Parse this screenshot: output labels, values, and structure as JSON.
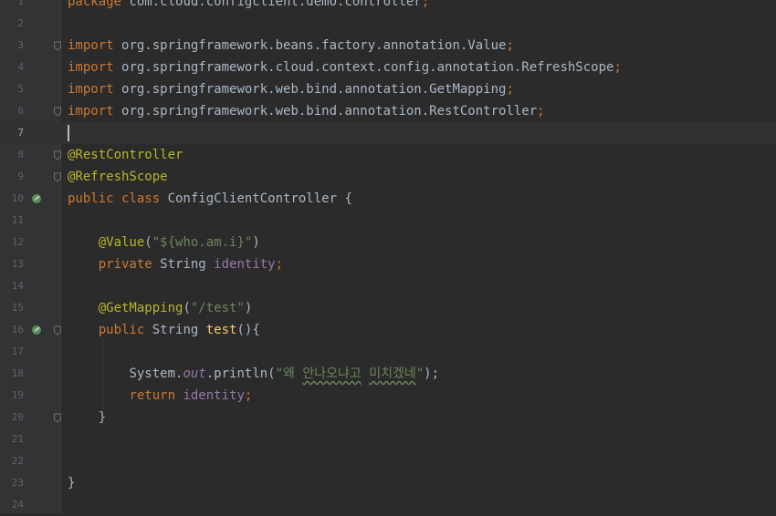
{
  "editor": {
    "current_line": 7,
    "lines": [
      {
        "n": "1",
        "tokens": [
          {
            "t": "package ",
            "c": "kw"
          },
          {
            "t": "com.cloud.configclient.demo.controller",
            "c": "plain"
          },
          {
            "t": ";",
            "c": "kw"
          }
        ]
      },
      {
        "n": "2",
        "tokens": []
      },
      {
        "n": "3",
        "fold": true,
        "tokens": [
          {
            "t": "import ",
            "c": "kw"
          },
          {
            "t": "org.springframework.beans.factory.annotation.Value",
            "c": "plain"
          },
          {
            "t": ";",
            "c": "kw"
          }
        ]
      },
      {
        "n": "4",
        "tokens": [
          {
            "t": "import ",
            "c": "kw"
          },
          {
            "t": "org.springframework.cloud.context.config.annotation.RefreshScope",
            "c": "plain"
          },
          {
            "t": ";",
            "c": "kw"
          }
        ]
      },
      {
        "n": "5",
        "tokens": [
          {
            "t": "import ",
            "c": "kw"
          },
          {
            "t": "org.springframework.web.bind.annotation.GetMapping",
            "c": "plain"
          },
          {
            "t": ";",
            "c": "kw"
          }
        ]
      },
      {
        "n": "6",
        "fold": true,
        "tokens": [
          {
            "t": "import ",
            "c": "kw"
          },
          {
            "t": "org.springframework.web.bind.annotation.RestController",
            "c": "plain"
          },
          {
            "t": ";",
            "c": "kw"
          }
        ]
      },
      {
        "n": "7",
        "tokens": []
      },
      {
        "n": "8",
        "fold": true,
        "tokens": [
          {
            "t": "@RestController",
            "c": "ann"
          }
        ]
      },
      {
        "n": "9",
        "fold": true,
        "tokens": [
          {
            "t": "@RefreshScope",
            "c": "ann"
          }
        ]
      },
      {
        "n": "10",
        "icon": true,
        "tokens": [
          {
            "t": "public class ",
            "c": "kw"
          },
          {
            "t": "ConfigClientController {",
            "c": "plain"
          }
        ]
      },
      {
        "n": "11",
        "tokens": []
      },
      {
        "n": "12",
        "tokens": [
          {
            "t": "    ",
            "c": "plain"
          },
          {
            "t": "@Value",
            "c": "ann"
          },
          {
            "t": "(",
            "c": "plain"
          },
          {
            "t": "\"${who.am.i}\"",
            "c": "str"
          },
          {
            "t": ")",
            "c": "plain"
          }
        ]
      },
      {
        "n": "13",
        "tokens": [
          {
            "t": "    ",
            "c": "plain"
          },
          {
            "t": "private ",
            "c": "kw"
          },
          {
            "t": "String ",
            "c": "plain"
          },
          {
            "t": "identity",
            "c": "fld"
          },
          {
            "t": ";",
            "c": "kw"
          }
        ]
      },
      {
        "n": "14",
        "tokens": []
      },
      {
        "n": "15",
        "tokens": [
          {
            "t": "    ",
            "c": "plain"
          },
          {
            "t": "@GetMapping",
            "c": "ann"
          },
          {
            "t": "(",
            "c": "plain"
          },
          {
            "t": "\"/test\"",
            "c": "str"
          },
          {
            "t": ")",
            "c": "plain"
          }
        ]
      },
      {
        "n": "16",
        "icon": true,
        "fold": true,
        "tokens": [
          {
            "t": "    ",
            "c": "plain"
          },
          {
            "t": "public ",
            "c": "kw"
          },
          {
            "t": "String ",
            "c": "plain"
          },
          {
            "t": "test",
            "c": "fn"
          },
          {
            "t": "(){",
            "c": "plain"
          }
        ]
      },
      {
        "n": "17",
        "tokens": []
      },
      {
        "n": "18",
        "tokens": [
          {
            "t": "        ",
            "c": "plain"
          },
          {
            "t": "System.",
            "c": "plain"
          },
          {
            "t": "out",
            "c": "fldi"
          },
          {
            "t": ".println(",
            "c": "plain"
          },
          {
            "t": "\"왜 ",
            "c": "str"
          },
          {
            "t": "안나오냐고",
            "c": "str typo"
          },
          {
            "t": " ",
            "c": "str"
          },
          {
            "t": "미치겠네",
            "c": "str typo"
          },
          {
            "t": "\"",
            "c": "str"
          },
          {
            "t": ");",
            "c": "plain"
          }
        ]
      },
      {
        "n": "19",
        "tokens": [
          {
            "t": "        ",
            "c": "plain"
          },
          {
            "t": "return ",
            "c": "kw"
          },
          {
            "t": "identity",
            "c": "fld"
          },
          {
            "t": ";",
            "c": "kw"
          }
        ]
      },
      {
        "n": "20",
        "fold": true,
        "tokens": [
          {
            "t": "    }",
            "c": "plain"
          }
        ]
      },
      {
        "n": "21",
        "tokens": []
      },
      {
        "n": "22",
        "tokens": []
      },
      {
        "n": "23",
        "tokens": [
          {
            "t": "}",
            "c": "plain"
          }
        ]
      },
      {
        "n": "24",
        "tokens": []
      }
    ]
  },
  "colors": {
    "background": "#2b2b2b",
    "gutter": "#313335",
    "keyword": "#cc7832",
    "annotation": "#bbb529",
    "string": "#6a8759",
    "field": "#9876aa",
    "method": "#ffc66d",
    "text": "#a9b7c6",
    "line_number": "#606366"
  },
  "icons": {
    "gutter_marker": "spring-bean-icon",
    "fold_marker": "fold-icon"
  }
}
